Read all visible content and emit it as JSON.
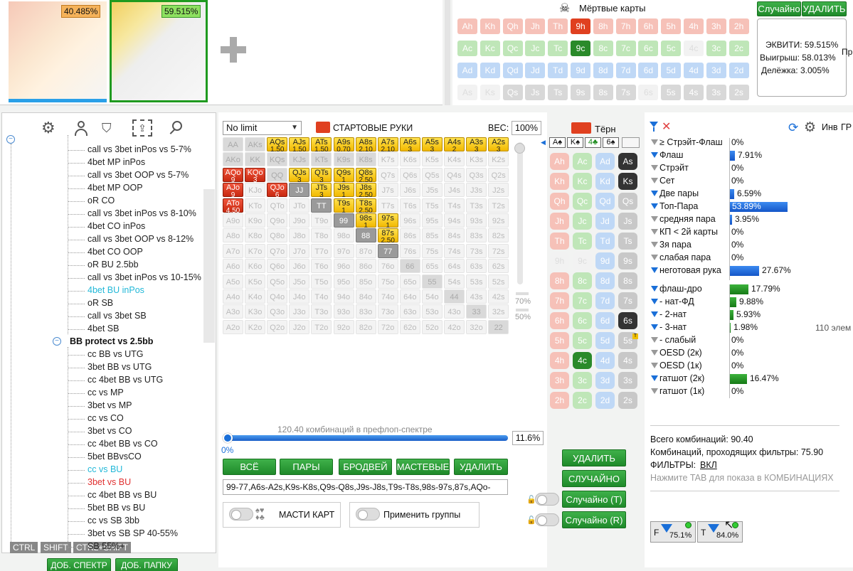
{
  "top": {
    "range1": {
      "pct": "40.485%"
    },
    "range2": {
      "pct": "59.515%"
    },
    "add_icon": "plus-icon",
    "dead_title": "Мёртвые карты",
    "random_btn": "Случайно",
    "delete_btn": "УДАЛИТЬ",
    "dead_rows": [
      [
        "Ah",
        "Kh",
        "Qh",
        "Jh",
        "Th",
        "9h",
        "8h",
        "7h",
        "6h",
        "5h",
        "4h",
        "3h",
        "2h"
      ],
      [
        "Ac",
        "Kc",
        "Qc",
        "Jc",
        "Tc",
        "9c",
        "8c",
        "7c",
        "6c",
        "5c",
        "4c",
        "3c",
        "2c"
      ],
      [
        "Ad",
        "Kd",
        "Qd",
        "Jd",
        "Td",
        "9d",
        "8d",
        "7d",
        "6d",
        "5d",
        "4d",
        "3d",
        "2d"
      ],
      [
        "As",
        "Ks",
        "Qs",
        "Js",
        "Ts",
        "9s",
        "8s",
        "7s",
        "6s",
        "5s",
        "4s",
        "3s",
        "2s"
      ]
    ],
    "equity": {
      "line1": "ЭКВИТИ: 59.515%",
      "line2": "Выигрыш: 58.013%",
      "line3": "Делёжка: 3.005%",
      "trunc": "Пр"
    }
  },
  "tree": {
    "items": [
      {
        "label": "call vs 3bet inPos vs 5-7%",
        "color": "#222"
      },
      {
        "label": "4bet MP inPos",
        "color": "#222"
      },
      {
        "label": "call vs 3bet OOP vs 5-7%",
        "color": "#222"
      },
      {
        "label": "4bet MP OOP",
        "color": "#222"
      },
      {
        "label": "oR CO",
        "color": "#222"
      },
      {
        "label": "call vs 3bet inPos vs 8-10%",
        "color": "#222"
      },
      {
        "label": "4bet CO inPos",
        "color": "#222"
      },
      {
        "label": "call vs 3bet OOP vs 8-12%",
        "color": "#222"
      },
      {
        "label": "4bet CO OOP",
        "color": "#222"
      },
      {
        "label": "oR BU 2.5bb",
        "color": "#222"
      },
      {
        "label": "call vs 3bet inPos vs 10-15%",
        "color": "#222"
      },
      {
        "label": "4bet BU inPos",
        "color": "#22b8d8"
      },
      {
        "label": "oR SB",
        "color": "#222"
      },
      {
        "label": "call vs 3bet SB",
        "color": "#222"
      },
      {
        "label": "4bet SB",
        "color": "#222"
      }
    ],
    "folder": "BB protect vs 2.5bb",
    "sub_items": [
      {
        "label": "cc BB vs UTG",
        "color": "#222"
      },
      {
        "label": "3bet BB vs UTG",
        "color": "#222"
      },
      {
        "label": "cc 4bet BB vs UTG",
        "color": "#222"
      },
      {
        "label": "cc vs MP",
        "color": "#222"
      },
      {
        "label": "3bet vs MP",
        "color": "#222"
      },
      {
        "label": "cc vs CO",
        "color": "#222"
      },
      {
        "label": "3bet vs CO",
        "color": "#222"
      },
      {
        "label": "cc 4bet BB vs CO",
        "color": "#222"
      },
      {
        "label": "5bet BBvsCO",
        "color": "#222"
      },
      {
        "label": "cc vs BU",
        "color": "#22b8d8"
      },
      {
        "label": "3bet vs BU",
        "color": "#e03030"
      },
      {
        "label": "cc 4bet BB vs BU",
        "color": "#222"
      },
      {
        "label": "5bet BB vs BU",
        "color": "#222"
      },
      {
        "label": "cc vs SB 3bb",
        "color": "#222"
      },
      {
        "label": "3bet vs SB SP 40-55%",
        "color": "#222"
      },
      {
        "label": "SB 55%+",
        "color": "#222"
      }
    ],
    "keys": [
      "CTRL",
      "SHIFT",
      "CTRL+SHIFT"
    ],
    "add_range": "ДОБ. СПЕКТР",
    "add_folder": "ДОБ. ПАПКУ"
  },
  "matrix": {
    "game_select": "No limit",
    "title": "СТАРТОВЫЕ РУКИ",
    "weight_label": "ВЕС:",
    "weight_value": "100%",
    "slider_pct1": "70%",
    "slider_pct2": "50%",
    "combos_text": "120.40 комбинаций в префлоп-спектре",
    "progress_pct": "11.6%",
    "progress_zero": "0%",
    "buttons": [
      "ВСЁ",
      "ПАРЫ",
      "БРОДВЕЙ",
      "МАСТЕВЫЕ",
      "УДАЛИТЬ"
    ],
    "range_text": "99-77,A6s-A2s,K9s-K8s,Q9s-Q8s,J9s-J8s,T9s-T8s,98s-97s,87s,AQo-",
    "suits_toggle": "МАСТИ КАРТ",
    "groups_toggle": "Применить группы"
  },
  "turn": {
    "title": "Тёрн",
    "board": [
      "A♠",
      "K♠",
      "4♣",
      "6♠"
    ],
    "delete": "УДАЛИТЬ",
    "random": "СЛУЧАЙНО",
    "random_t": "Случайно (T)",
    "random_r": "Случайно (R)"
  },
  "stats": {
    "rows": [
      {
        "label": "≥ Стрэйт-Флаш",
        "pct": "0%",
        "w": 0,
        "active": false
      },
      {
        "label": "Флаш",
        "pct": "7.91%",
        "w": 8,
        "active": true
      },
      {
        "label": "Стрэйт",
        "pct": "0%",
        "w": 0,
        "active": false
      },
      {
        "label": "Сет",
        "pct": "0%",
        "w": 0,
        "active": false
      },
      {
        "label": "Две пары",
        "pct": "6.59%",
        "w": 7,
        "active": true
      },
      {
        "label": "Топ-Пара",
        "pct": "53.89%",
        "w": 82,
        "active": true
      },
      {
        "label": "средняя пара",
        "pct": "3.95%",
        "w": 4,
        "active": false
      },
      {
        "label": "КП < 2й карты",
        "pct": "0%",
        "w": 0,
        "active": false
      },
      {
        "label": "3я пара",
        "pct": "0%",
        "w": 0,
        "active": false
      },
      {
        "label": "слабая пара",
        "pct": "0%",
        "w": 0,
        "active": false
      },
      {
        "label": "неготовая рука",
        "pct": "27.67%",
        "w": 42,
        "active": true
      }
    ],
    "draws": [
      {
        "label": "флаш-дро",
        "pct": "17.79%",
        "w": 27,
        "active": true
      },
      {
        "label": "- нат-ФД",
        "pct": "9.88%",
        "w": 10,
        "active": true
      },
      {
        "label": "- 2-нат",
        "pct": "5.93%",
        "w": 6,
        "active": true
      },
      {
        "label": "- 3-нат",
        "pct": "1.98%",
        "w": 2,
        "active": true
      },
      {
        "label": "- слабый",
        "pct": "0%",
        "w": 0,
        "active": false
      },
      {
        "label": "OESD (2к)",
        "pct": "0%",
        "w": 0,
        "active": false
      },
      {
        "label": "OESD (1к)",
        "pct": "0%",
        "w": 0,
        "active": false
      },
      {
        "label": "гатшот (2к)",
        "pct": "16.47%",
        "w": 25,
        "active": true
      },
      {
        "label": "гатшот (1к)",
        "pct": "0%",
        "w": 0,
        "active": false
      }
    ],
    "elements": "110 элем",
    "inv": "Инв",
    "gr": "ГР",
    "total": "Всего комбинаций: 90.40",
    "passing": "Комбинаций, проходящих фильтры: 75.90",
    "filters_label": "ФИЛЬТРЫ:",
    "filters_value": "ВКЛ",
    "tab_hint": "Нажмите TAB для показа в КОМБИНАЦИЯХ",
    "f_pct": "75.1%",
    "t_pct": "84.0%"
  }
}
